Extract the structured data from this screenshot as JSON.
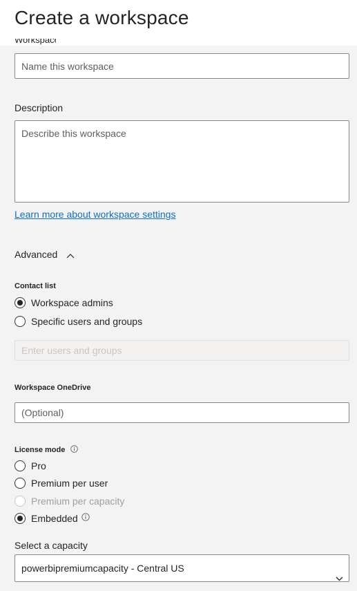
{
  "header": {
    "title": "Create a workspace"
  },
  "workspace_name": {
    "label_partial": "Workspace name",
    "placeholder": "Name this workspace"
  },
  "description": {
    "label": "Description",
    "placeholder": "Describe this workspace"
  },
  "learn_more_link": "Learn more about workspace settings",
  "advanced": {
    "label": "Advanced",
    "expanded": true
  },
  "contact_list": {
    "label": "Contact list",
    "options": [
      {
        "label": "Workspace admins",
        "selected": true
      },
      {
        "label": "Specific users and groups",
        "selected": false
      }
    ],
    "users_placeholder": "Enter users and groups"
  },
  "onedrive": {
    "label": "Workspace OneDrive",
    "placeholder": "(Optional)"
  },
  "license_mode": {
    "label": "License mode",
    "options": [
      {
        "label": "Pro",
        "selected": false,
        "disabled": false
      },
      {
        "label": "Premium per user",
        "selected": false,
        "disabled": false
      },
      {
        "label": "Premium per capacity",
        "selected": false,
        "disabled": true
      },
      {
        "label": "Embedded",
        "selected": true,
        "disabled": false
      }
    ]
  },
  "capacity": {
    "label": "Select a capacity",
    "selected": "powerbipremiumcapacity - Central US"
  },
  "icons": {
    "advanced_toggle": "chevron-up-icon",
    "info": "info-icon",
    "select": "chevron-down-icon"
  },
  "colors": {
    "link": "#106ebe",
    "background": "#f3f3f3",
    "header": "#ffffff"
  }
}
